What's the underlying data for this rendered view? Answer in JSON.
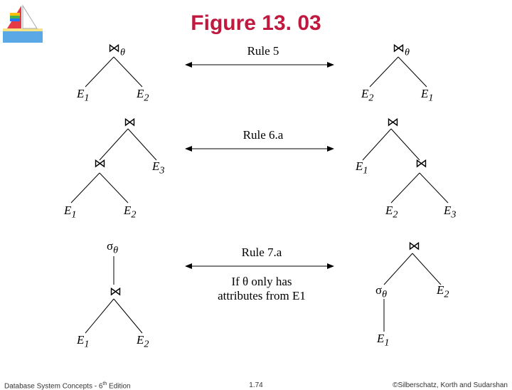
{
  "title": "Figure 13. 03",
  "footer": {
    "left_a": "Database System Concepts - 6",
    "left_b": "th",
    "left_c": " Edition",
    "center": "1.74",
    "right": "©Silberschatz, Korth and Sudarshan"
  },
  "rules": {
    "r5": "Rule 5",
    "r6a": "Rule 6.a",
    "r7a": "Rule 7.a",
    "r7cond1": "If θ only has",
    "r7cond2": "attributes from E1"
  },
  "sym": {
    "join": "⋈",
    "theta": "θ",
    "sigma": "σ",
    "E1": "E",
    "E2": "E",
    "E3": "E",
    "s1": "1",
    "s2": "2",
    "s3": "3"
  }
}
